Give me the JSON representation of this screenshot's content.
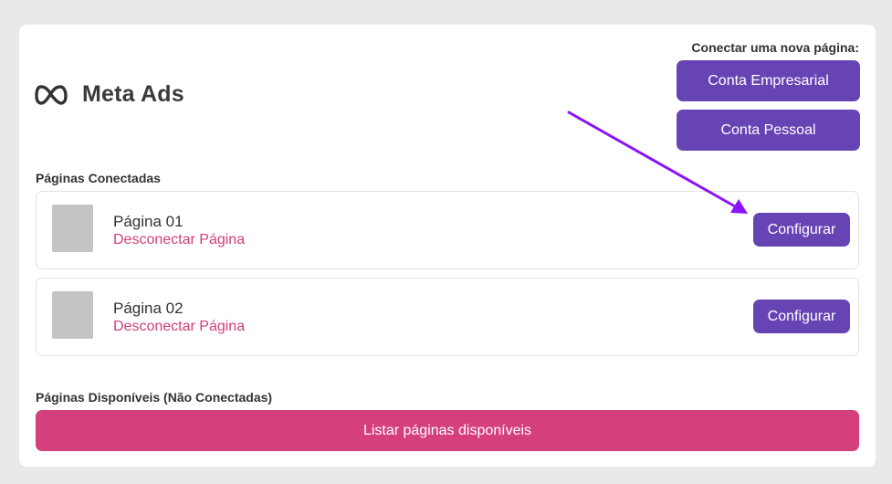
{
  "brand": {
    "title": "Meta Ads",
    "icon": "meta-infinity-icon"
  },
  "connect": {
    "label": "Conectar uma nova página:",
    "business_button": "Conta Empresarial",
    "personal_button": "Conta Pessoal"
  },
  "connected": {
    "title": "Páginas Conectadas",
    "pages": [
      {
        "name": "Página 01",
        "disconnect_label": "Desconectar Página",
        "config_label": "Configurar"
      },
      {
        "name": "Página 02",
        "disconnect_label": "Desconectar Página",
        "config_label": "Configurar"
      }
    ]
  },
  "available": {
    "title": "Páginas Disponíveis (Não Conectadas)",
    "list_button": "Listar páginas disponíveis"
  },
  "colors": {
    "background": "#e9e9e9",
    "card": "#ffffff",
    "purple": "#6744b4",
    "pink": "#d43f7c",
    "link_pink": "#cf3f79",
    "annotation_arrow": "#8a14f5"
  }
}
